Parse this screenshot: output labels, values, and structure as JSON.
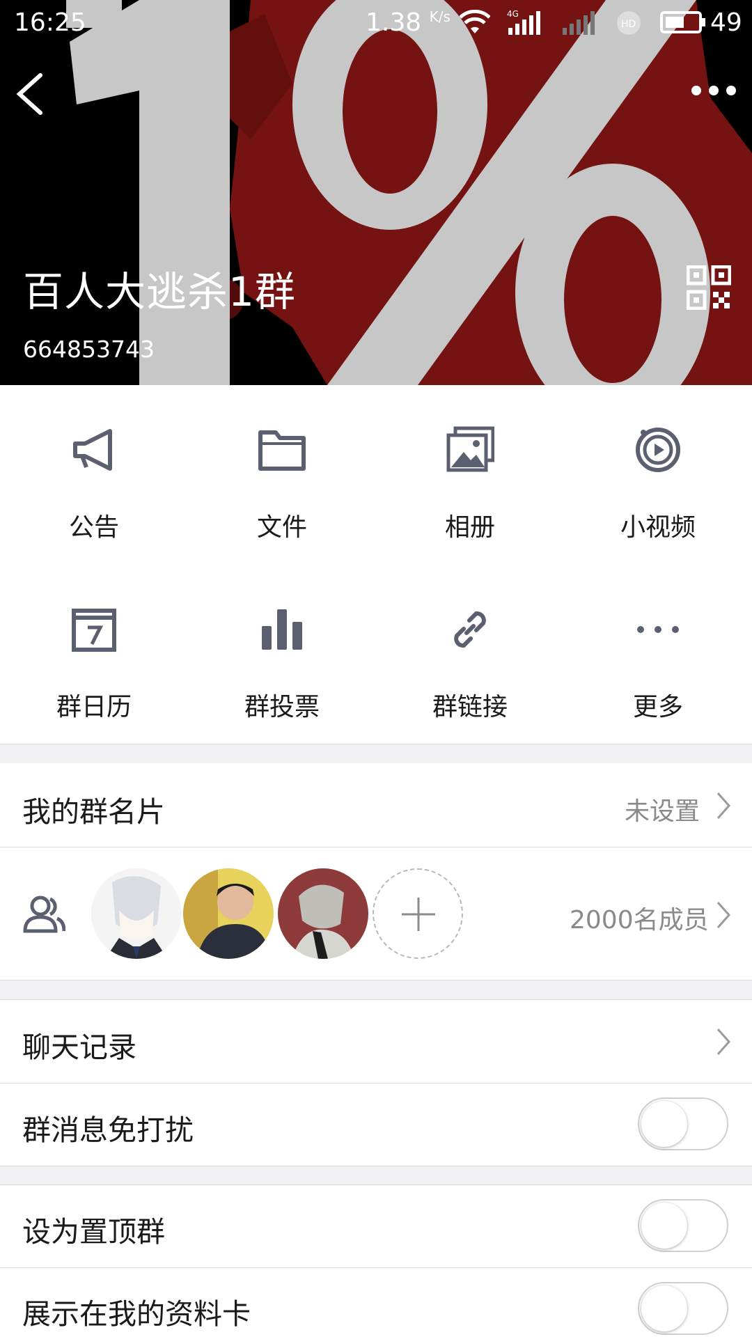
{
  "status_bar": {
    "time": "16:25",
    "net_speed": "1.38",
    "net_speed_unit": "K/s",
    "network_type": "4G",
    "battery": "49"
  },
  "header": {
    "group_name": "百人大逃杀1群",
    "group_id": "664853743",
    "icons": [
      "back-arrow-icon",
      "more-dots-icon",
      "qr-code-icon"
    ]
  },
  "tools": [
    {
      "label": "公告",
      "icon": "megaphone-icon"
    },
    {
      "label": "文件",
      "icon": "folder-icon"
    },
    {
      "label": "相册",
      "icon": "photo-album-icon"
    },
    {
      "label": "小视频",
      "icon": "video-play-icon"
    },
    {
      "label": "群日历",
      "icon": "calendar-icon"
    },
    {
      "label": "群投票",
      "icon": "bar-chart-icon"
    },
    {
      "label": "群链接",
      "icon": "link-icon"
    },
    {
      "label": "更多",
      "icon": "more-dots-icon"
    }
  ],
  "card": {
    "label": "我的群名片",
    "value": "未设置"
  },
  "members": {
    "count_label": "2000名成员"
  },
  "chat_history": {
    "label": "聊天记录"
  },
  "settings": [
    {
      "label": "群消息免打扰",
      "on": false
    },
    {
      "label": "设为置顶群",
      "on": false
    },
    {
      "label": "展示在我的资料卡",
      "on": false
    }
  ],
  "colors": {
    "icon_gray": "#5b6070",
    "header_red": "#7e1514",
    "toggle_border": "#cfcfd3"
  }
}
